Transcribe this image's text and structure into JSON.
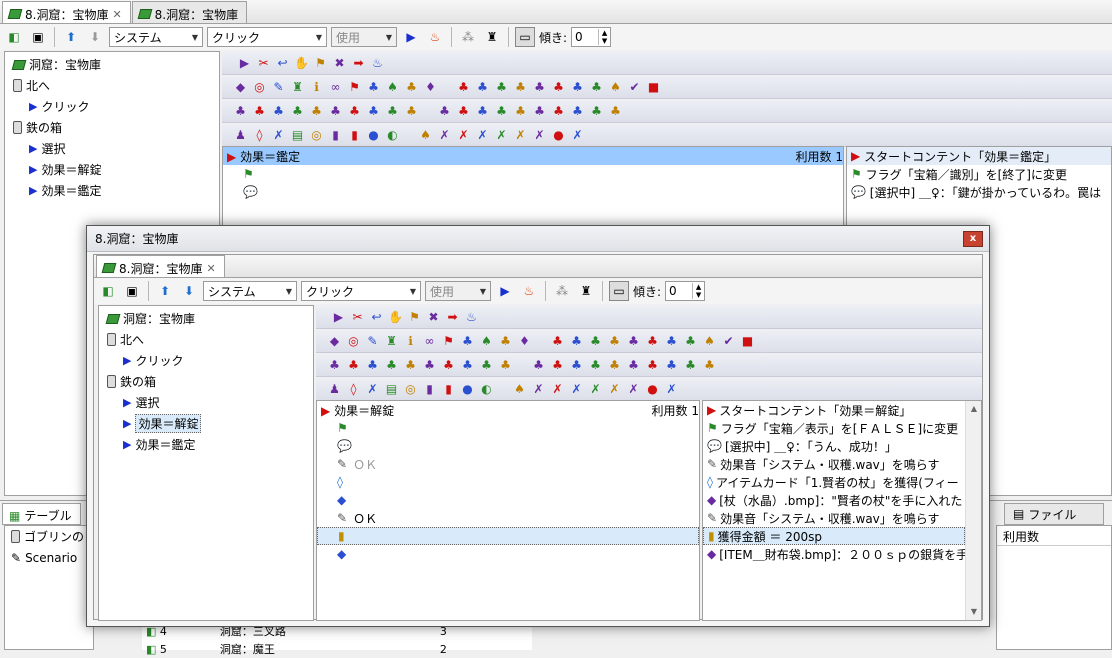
{
  "back": {
    "tabs": [
      {
        "label": "8.洞窟：宝物庫",
        "closable": true
      },
      {
        "label": "8.洞窟：宝物庫",
        "closable": false
      }
    ],
    "toolbar": {
      "system_combo": "システム",
      "click_combo": "クリック",
      "use_combo": "使用",
      "tilt_label": "傾き:",
      "tilt_value": "0"
    },
    "tree": [
      {
        "label": "洞窟：宝物庫",
        "icon": "area-icon",
        "level": 0
      },
      {
        "label": "北へ",
        "icon": "door-icon",
        "level": 0
      },
      {
        "label": "クリック",
        "icon": "start-icon",
        "level": 1
      },
      {
        "label": "鉄の箱",
        "icon": "door-icon",
        "level": 0
      },
      {
        "label": "選択",
        "icon": "start-icon",
        "level": 1
      },
      {
        "label": "効果＝解錠",
        "icon": "start-icon",
        "level": 1
      },
      {
        "label": "効果＝鑑定",
        "icon": "start-icon",
        "level": 1
      }
    ],
    "event_header": {
      "label": "効果＝鑑定",
      "usage_label": "利用数",
      "usage_count": "1"
    },
    "content_list": [
      "スタートコンテント「効果＝鑑定」",
      "フラグ「宝箱／識別」を[終了]に変更",
      "[選択中] ＿♀：「鍵が掛かっているわ。罠は"
    ],
    "bottom_tabs": {
      "table": "テーブル",
      "file": "ファイル"
    },
    "bottom_left_items": [
      "ゴブリンの",
      "Scenario"
    ],
    "bottom_table_header": "利用数",
    "bottom_rows": [
      {
        "num": "4",
        "name": "洞窟：三叉路",
        "count": "3"
      },
      {
        "num": "5",
        "name": "洞窟：魔王",
        "count": "2"
      }
    ]
  },
  "dialog": {
    "title": "8.洞窟：宝物庫",
    "close_label": "x",
    "tab": "8.洞窟：宝物庫",
    "toolbar": {
      "system_combo": "システム",
      "click_combo": "クリック",
      "use_combo": "使用",
      "tilt_label": "傾き:",
      "tilt_value": "0"
    },
    "tree": [
      {
        "label": "洞窟：宝物庫",
        "icon": "area-icon",
        "level": 0
      },
      {
        "label": "北へ",
        "icon": "door-icon",
        "level": 0
      },
      {
        "label": "クリック",
        "icon": "start-icon",
        "level": 1
      },
      {
        "label": "鉄の箱",
        "icon": "door-icon",
        "level": 0
      },
      {
        "label": "選択",
        "icon": "start-icon",
        "level": 1
      },
      {
        "label": "効果＝解錠",
        "icon": "start-icon",
        "level": 1,
        "selected": true
      },
      {
        "label": "効果＝鑑定",
        "icon": "start-icon",
        "level": 1
      }
    ],
    "event_header": {
      "label": "効果＝解錠",
      "usage_label": "利用数",
      "usage_count": "1"
    },
    "event_nodes": [
      {
        "label": "",
        "gray": false
      },
      {
        "label": "",
        "gray": false
      },
      {
        "label": "ＯＫ",
        "gray": true
      },
      {
        "label": "",
        "gray": false
      },
      {
        "label": "",
        "gray": false
      },
      {
        "label": "ＯＫ",
        "gray": false
      },
      {
        "label": "",
        "gray": false,
        "selected": true
      },
      {
        "label": "",
        "gray": false
      }
    ],
    "content_list": [
      {
        "text": "スタートコンテント「効果＝解錠」"
      },
      {
        "text": "フラグ「宝箱／表示」を[ＦＡＬＳＥ]に変更"
      },
      {
        "text": "[選択中] ＿♀：「うん、成功！」"
      },
      {
        "text": "効果音「システム・収穫.wav」を鳴らす"
      },
      {
        "text": "アイテムカード「1.賢者の杖」を獲得(フィー"
      },
      {
        "text": "[杖（水晶）.bmp]：\"賢者の杖\"を手に入れた"
      },
      {
        "text": "効果音「システム・収穫.wav」を鳴らす"
      },
      {
        "text": "獲得金額 ＝ 200sp",
        "selected": true
      },
      {
        "text": "[ITEM＿財布袋.bmp]：２００ｓｐの銀貨を手"
      }
    ]
  },
  "palette_icons": {
    "row1": [
      "▶",
      "✂",
      "↩",
      "✋",
      "⚑",
      "✖",
      "➡",
      "♨"
    ],
    "row2": [
      "◆",
      "◎",
      "✎",
      "♜",
      "ℹ",
      "∞",
      "⚑",
      "♣",
      "♠",
      "♣",
      "♦",
      "♣",
      "♣",
      "♣",
      "♣",
      "♣",
      "♣",
      "♣",
      "♣",
      "♠",
      "✔",
      "■"
    ],
    "row3": [
      "♣",
      "♣",
      "♣",
      "♣",
      "♣",
      "♣",
      "♣",
      "♣",
      "♣",
      "♣",
      "♣",
      "♣",
      "♣",
      "♣",
      "♣",
      "♣",
      "♣",
      "♣",
      "♣",
      "♣"
    ],
    "row4": [
      "♟",
      "◊",
      "✗",
      "▤",
      "◎",
      "▮",
      "▮",
      "●",
      "◐",
      "♠",
      "✗",
      "✗",
      "✗",
      "✗",
      "✗",
      "✗",
      "●",
      "✗"
    ]
  },
  "colors": {
    "accent": "#2060c0",
    "selection": "#99c9ff",
    "red": "#d01010"
  }
}
